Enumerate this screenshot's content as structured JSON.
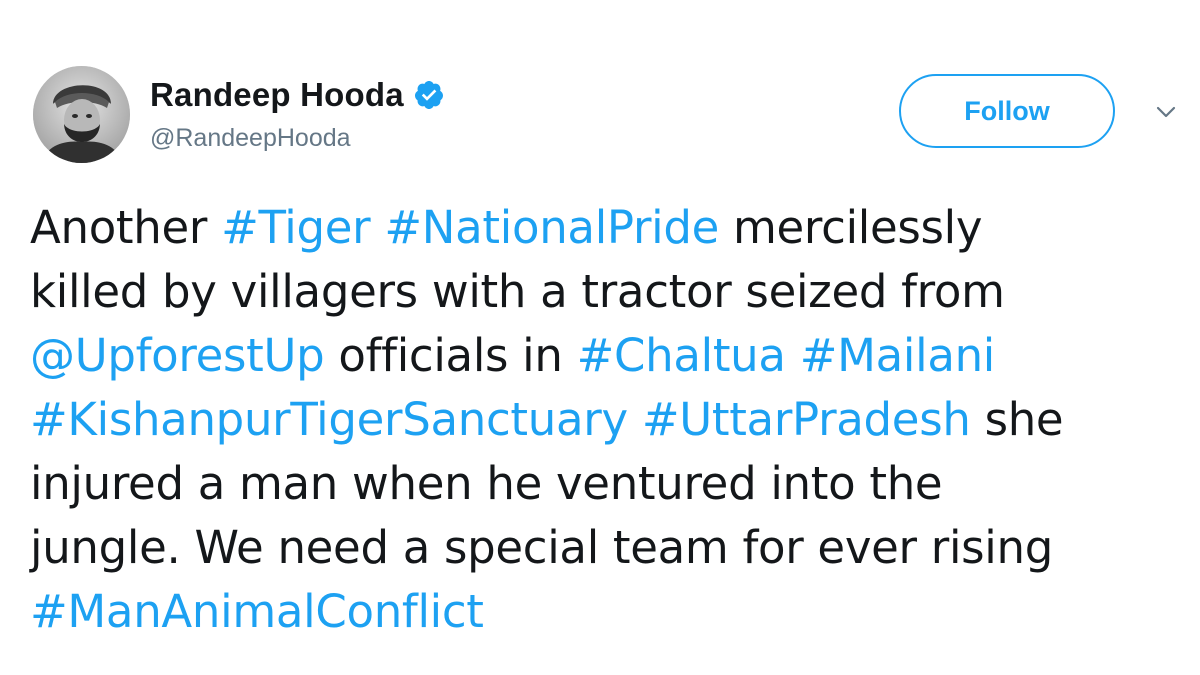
{
  "author": {
    "display_name": "Randeep Hooda",
    "username": "@RandeepHooda",
    "verified": true,
    "avatar_icon": "profile-photo"
  },
  "actions": {
    "follow_label": "Follow",
    "more_icon": "chevron-down-icon"
  },
  "colors": {
    "link": "#1da1f2",
    "text": "#14171a",
    "secondary": "#657786"
  },
  "tweet": {
    "lines": [
      [
        {
          "text": "Another ",
          "type": "text"
        },
        {
          "text": "#Tiger",
          "type": "hashtag"
        },
        {
          "text": " ",
          "type": "text"
        },
        {
          "text": "#NationalPride",
          "type": "hashtag"
        },
        {
          "text": " mercilessly",
          "type": "text"
        }
      ],
      [
        {
          "text": "killed by villagers with a tractor seized from",
          "type": "text"
        }
      ],
      [
        {
          "text": "@UpforestUp",
          "type": "mention"
        },
        {
          "text": " officials in ",
          "type": "text"
        },
        {
          "text": "#Chaltua",
          "type": "hashtag"
        },
        {
          "text": " ",
          "type": "text"
        },
        {
          "text": "#Mailani",
          "type": "hashtag"
        }
      ],
      [
        {
          "text": "#KishanpurTigerSanctuary",
          "type": "hashtag"
        },
        {
          "text": " ",
          "type": "text"
        },
        {
          "text": "#UttarPradesh",
          "type": "hashtag"
        },
        {
          "text": " she",
          "type": "text"
        }
      ],
      [
        {
          "text": "injured a man when he ventured into the",
          "type": "text"
        }
      ],
      [
        {
          "text": "jungle. We need a special team for ever rising",
          "type": "text"
        }
      ],
      [
        {
          "text": "#ManAnimalConflict",
          "type": "hashtag"
        }
      ]
    ]
  }
}
